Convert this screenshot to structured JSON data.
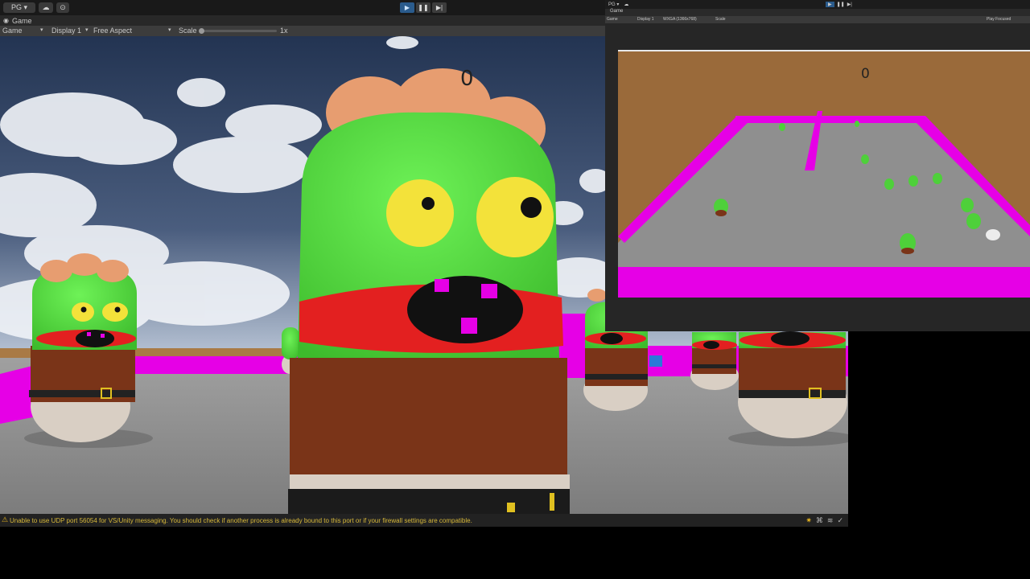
{
  "toolbar": {
    "account_label": "PG ▾",
    "play_buttons": [
      "▶",
      "❚❚",
      "▶|"
    ]
  },
  "game_tab": {
    "label": "Game",
    "mode": "Game",
    "display": "Display 1",
    "aspect": "Free Aspect",
    "scale_label": "Scale",
    "scale_value": "1x"
  },
  "viewport": {
    "score": "0"
  },
  "status_bar": {
    "message": "Unable to use UDP port 56054 for VS/Unity messaging. You should check if another process is already bound to this port or if your firewall settings are compatible."
  },
  "second_window": {
    "account_label": "PG ▾",
    "tab_label": "Game",
    "mode": "Game",
    "display": "Display 1",
    "resolution": "WXGA (1366x768)",
    "scale_label": "Scale",
    "focus_label": "Play Focused",
    "score": "0"
  },
  "colors": {
    "magenta": "#e600e6",
    "zombie_green": "#5ee04a",
    "floor": "#8f8f8f",
    "sky": "#2f3f5c",
    "wall_brown": "#9a6a3a",
    "status_warning": "#d7b83a"
  }
}
